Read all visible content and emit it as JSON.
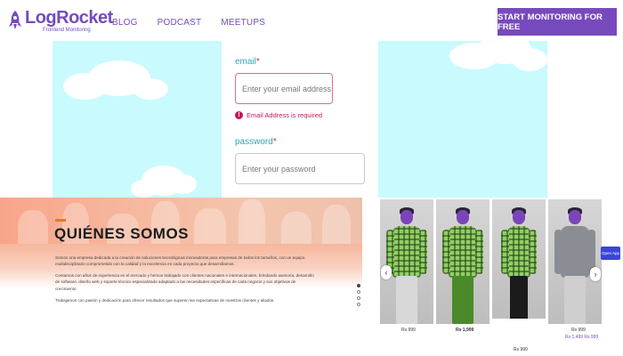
{
  "header": {
    "logo_text": "LogRocket",
    "logo_sub": "Frontend Monitoring",
    "nav": [
      "BLOG",
      "PODCAST",
      "MEETUPS"
    ],
    "cta_label": "START MONITORING FOR FREE"
  },
  "form": {
    "email_label": "email",
    "email_required": "*",
    "email_placeholder": "Enter your email address",
    "email_error": "Email Address is required",
    "password_label": "password",
    "password_required": "*",
    "password_placeholder": "Enter your password"
  },
  "about": {
    "title": "QUIÉNES SOMOS",
    "paragraphs": [
      "Somos una empresa dedicada a la creación de soluciones tecnológicas innovadoras para empresas de todos los tamaños, con un equipo multidisciplinario comprometido con la calidad y la excelencia en cada proyecto que desarrollamos.",
      "Contamos con años de experiencia en el mercado y hemos trabajado con clientes nacionales e internacionales, brindando asesoría, desarrollo de software, diseño web y soporte técnico especializado adaptado a las necesidades específicas de cada negocio y sus objetivos de crecimiento.",
      "Trabajamos con pasión y dedicación para ofrecer resultados que superen las expectativas de nuestros clientes y aliados."
    ],
    "slides": 4,
    "active_slide": 0
  },
  "products": {
    "items": [
      {
        "price": "Rs 999",
        "style": "check"
      },
      {
        "price": "Rs 1,999",
        "style": "check"
      },
      {
        "price": "Rs 999",
        "style": "check-dark"
      },
      {
        "price": "Rs 999",
        "sub": "Rs 1,499 Rs 999",
        "style": "grey"
      }
    ],
    "prev_icon": "‹",
    "next_icon": "›",
    "chip_label": "Open App"
  },
  "colors": {
    "brand": "#764abc",
    "sky": "#c9fafe",
    "label": "#2fa5b1",
    "error": "#c2185b",
    "accent": "#e8762f"
  }
}
